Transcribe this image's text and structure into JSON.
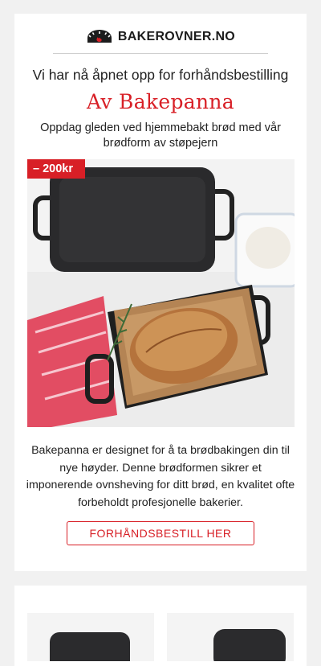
{
  "brand": {
    "name": "BAKEROVNER.NO",
    "logo_icon": "oven-flame-icon"
  },
  "hero": {
    "headline": "Vi har nå åpnet opp for forhåndsbestilling",
    "title": "Av Bakepanna",
    "subtitle": "Oppdag gleden ved hjemmebakt brød med vår brødform av støpejern",
    "badge": "– 200kr"
  },
  "description": "Bakepanna er designet for å ta brødbakingen din til nye høyder. Denne brødformen sikrer et imponerende ovnsheving for ditt brød, en kvalitet ofte forbeholdt profesjonelle bakerier.",
  "cta": {
    "label": "FORHÅNDSBESTILL HER"
  },
  "colors": {
    "accent": "#d81f26",
    "background": "#f1f1f1",
    "text": "#222222"
  }
}
